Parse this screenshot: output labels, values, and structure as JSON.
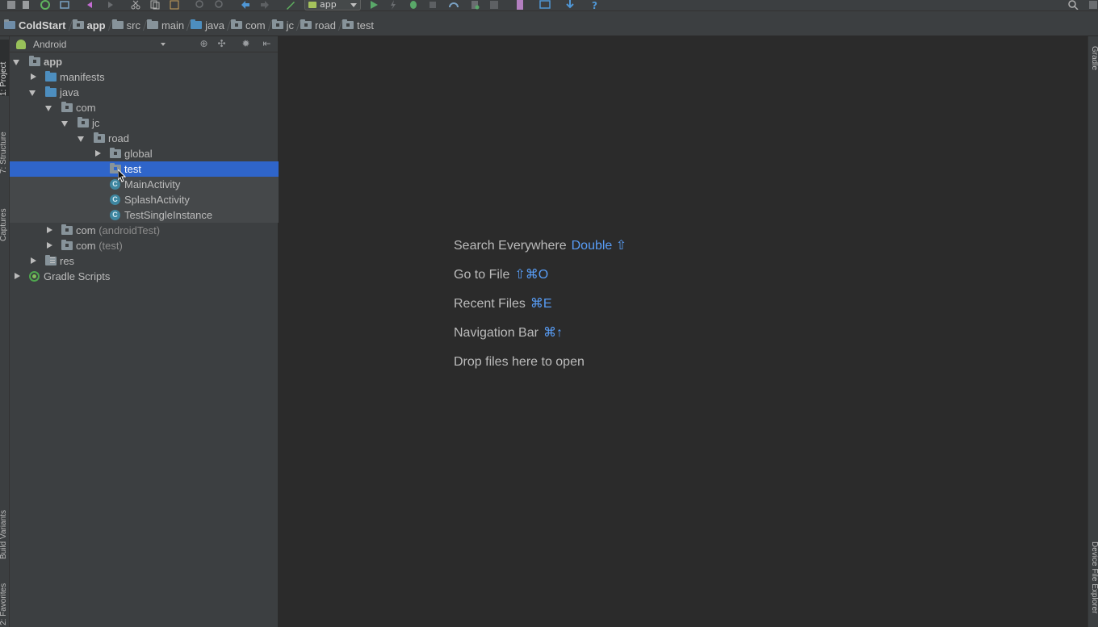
{
  "toolbar": {
    "run_config_label": "app",
    "icons": [
      "save-icon",
      "sync-icon",
      "refresh-icon",
      "undo-icon",
      "redo-icon",
      "cut-icon",
      "copy-icon",
      "paste-icon",
      "find-icon",
      "replace-icon",
      "back-icon",
      "forward-icon",
      "build-icon",
      "run-icon",
      "apply-changes-icon",
      "debug-icon",
      "attach-icon",
      "profile-icon",
      "coverage-icon",
      "stop-icon",
      "sdk-manager-icon",
      "avd-manager-icon",
      "download-icon",
      "help-icon",
      "search-icon"
    ]
  },
  "breadcrumb": [
    "ColdStart",
    "app",
    "src",
    "main",
    "java",
    "com",
    "jc",
    "road",
    "test"
  ],
  "left_tabs": {
    "project": "1: Project",
    "structure": "7: Structure",
    "captures": "Captures",
    "build_variants": "Build Variants",
    "favorites": "2: Favorites"
  },
  "right_tabs": {
    "gradle": "Gradle",
    "device_file_explorer": "Device File Explorer"
  },
  "project_panel": {
    "view_mode": "Android",
    "tree": {
      "app": "app",
      "manifests": "manifests",
      "java": "java",
      "com": "com",
      "jc": "jc",
      "road": "road",
      "global": "global",
      "test": "test",
      "main_activity": "MainActivity",
      "splash_activity": "SplashActivity",
      "test_single_instance": "TestSingleInstance",
      "com_android_test": "com",
      "com_android_test_suffix": "(androidTest)",
      "com_test": "com",
      "com_test_suffix": "(test)",
      "res": "res",
      "gradle_scripts": "Gradle Scripts"
    },
    "class_badge": "C"
  },
  "editor_hints": {
    "search_everywhere": {
      "label": "Search Everywhere",
      "shortcut": "Double ⇧"
    },
    "go_to_file": {
      "label": "Go to File",
      "shortcut": "⇧⌘O"
    },
    "recent_files": {
      "label": "Recent Files",
      "shortcut": "⌘E"
    },
    "navigation_bar": {
      "label": "Navigation Bar",
      "shortcut": "⌘↑"
    },
    "drop_files": {
      "label": "Drop files here to open"
    }
  },
  "colors": {
    "selection": "#2f65ca",
    "shortcut": "#589df6",
    "panel_bg": "#3c3f41",
    "editor_bg": "#2b2b2b"
  }
}
